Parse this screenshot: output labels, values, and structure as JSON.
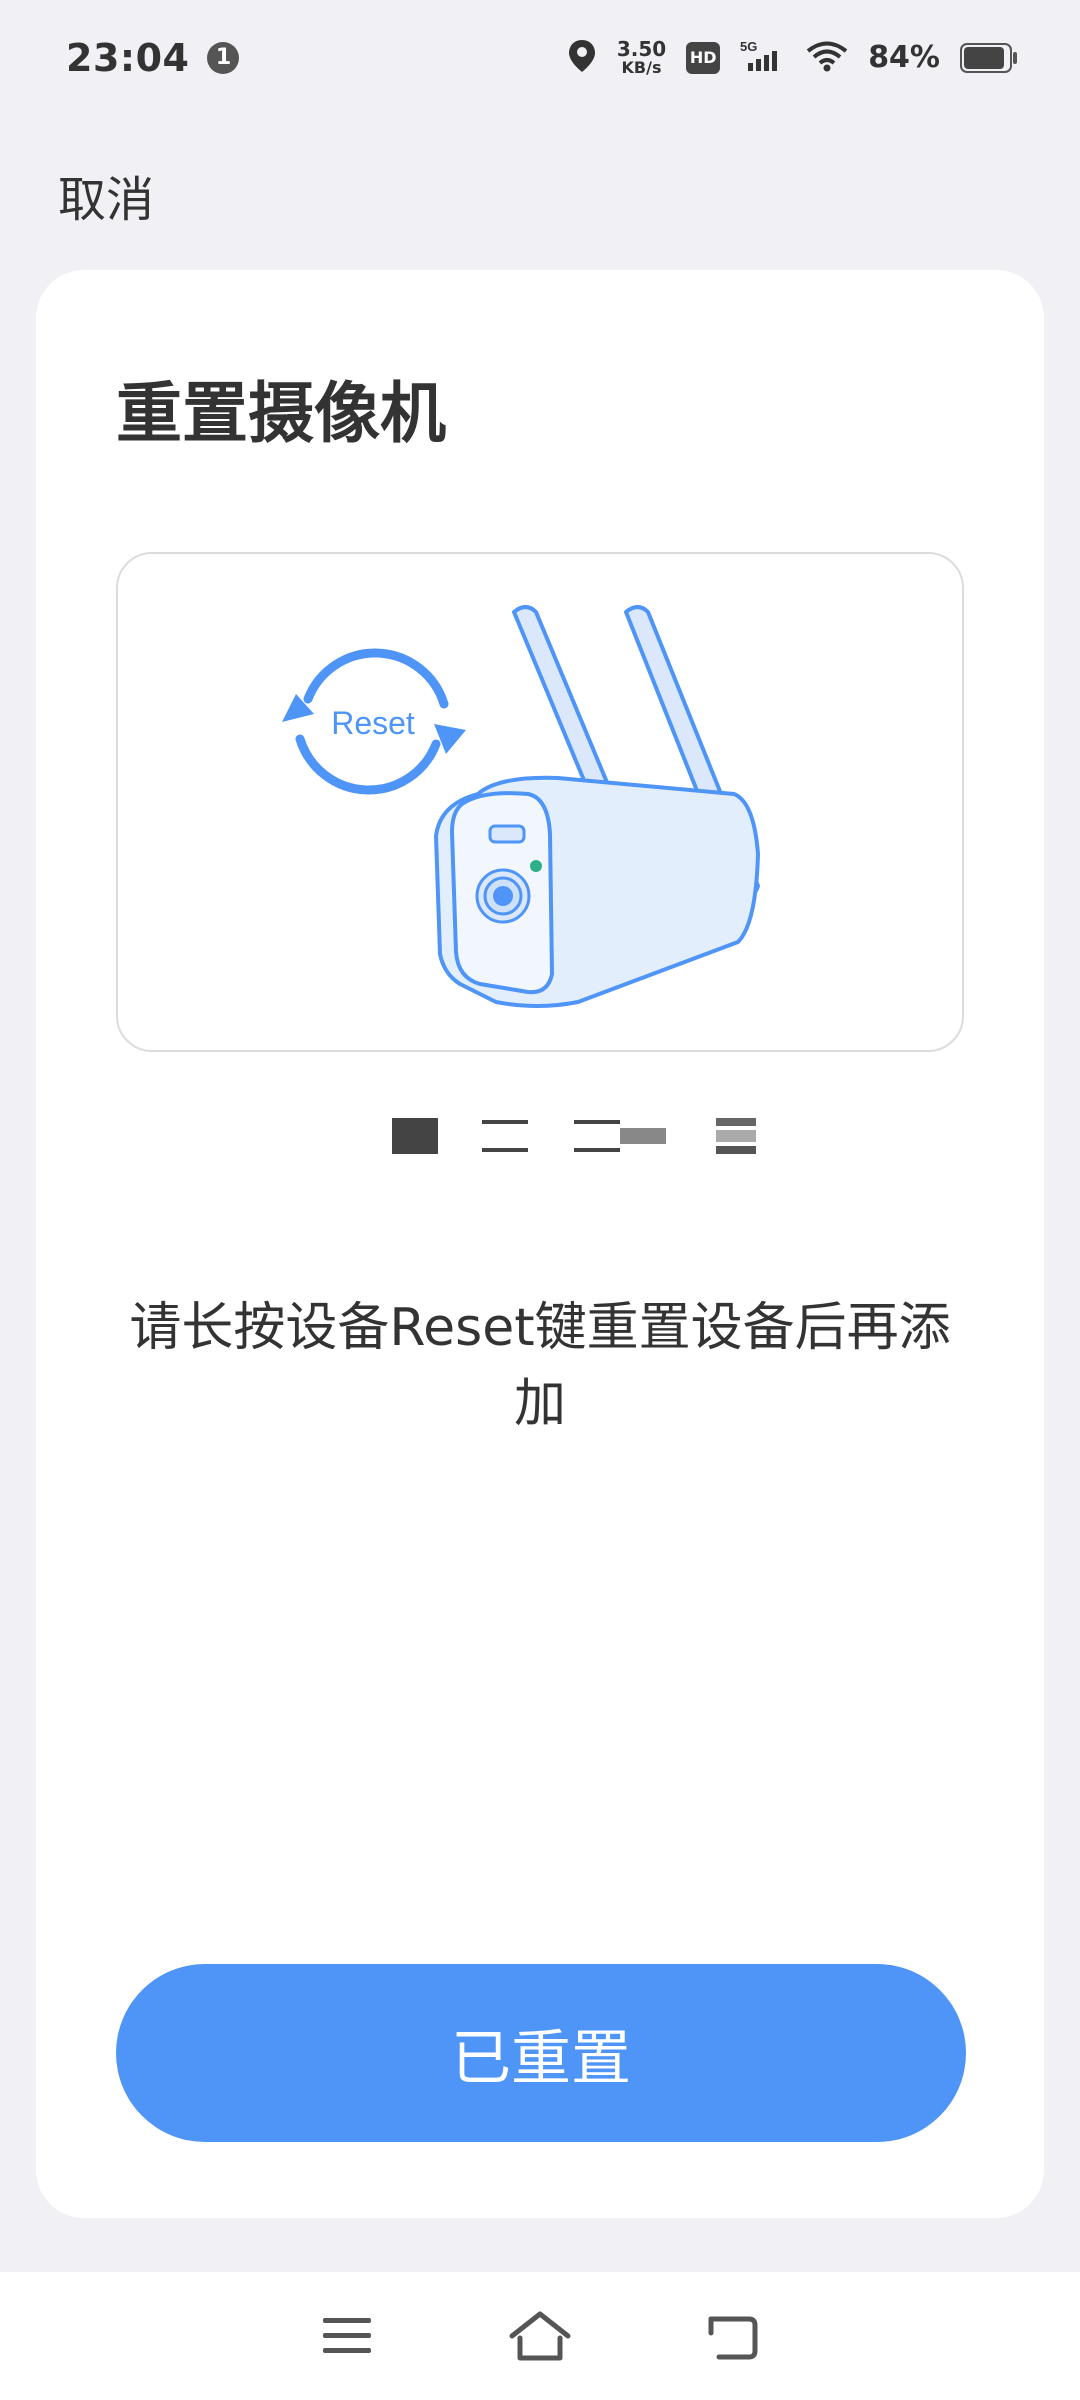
{
  "status_bar": {
    "time": "23:04",
    "notification_count": "1",
    "speed_value": "3.50",
    "speed_unit": "KB/s",
    "hd_label": "HD",
    "network": "5G",
    "battery": "84%"
  },
  "header": {
    "cancel_label": "取消"
  },
  "card": {
    "title": "重置摄像机",
    "illustration_label": "Reset",
    "step_count": 4,
    "active_step": 1,
    "instruction": "请长按设备Reset键重置设备后再添加",
    "confirm_label": "已重置"
  },
  "colors": {
    "accent": "#4e95f7",
    "background": "#f0f0f5",
    "card": "#ffffff"
  },
  "nav_bar": {
    "icons": [
      "menu-icon",
      "home-icon",
      "back-icon"
    ]
  }
}
